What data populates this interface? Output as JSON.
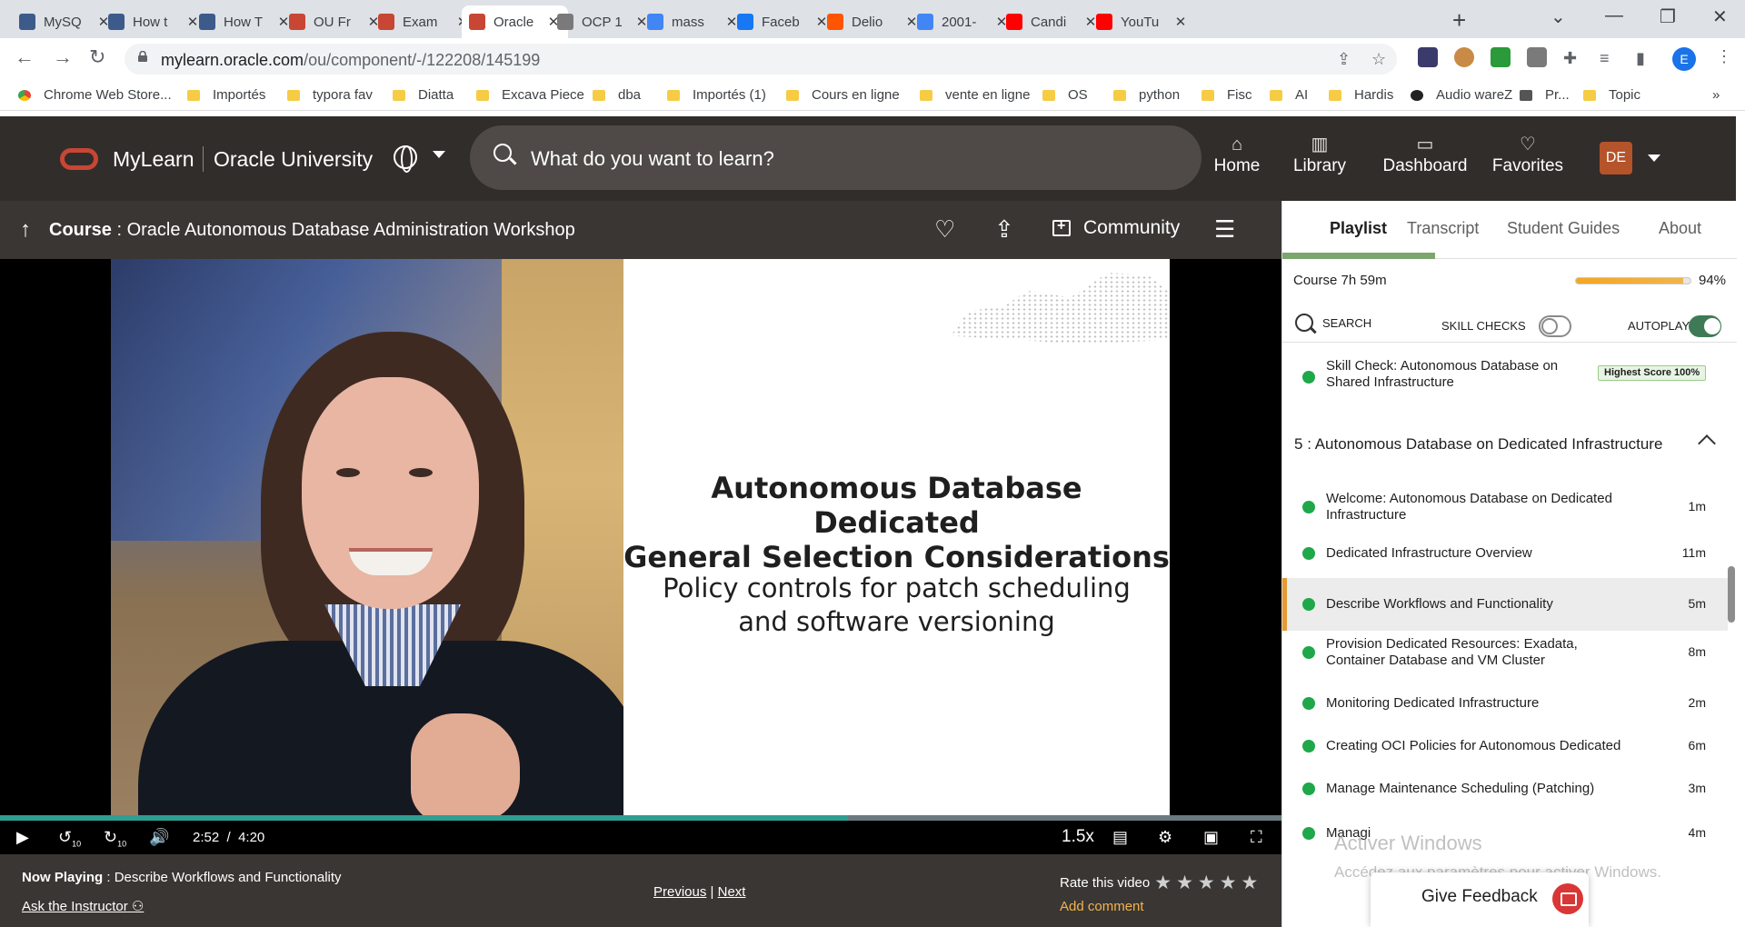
{
  "browser": {
    "tabs": [
      {
        "label": "MySQ",
        "color": "#3c5a8a"
      },
      {
        "label": "How t",
        "color": "#3c5a8a"
      },
      {
        "label": "How T",
        "color": "#3c5a8a"
      },
      {
        "label": "OU Fr",
        "color": "#c74634"
      },
      {
        "label": "Exam",
        "color": "#c74634"
      },
      {
        "label": "Oracle",
        "color": "#c74634"
      },
      {
        "label": "OCP 1",
        "color": "#7a7a7a"
      },
      {
        "label": "mass",
        "color": "#4285f4"
      },
      {
        "label": "Faceb",
        "color": "#1877f2"
      },
      {
        "label": "Delio",
        "color": "#ff5500"
      },
      {
        "label": "2001-",
        "color": "#4285f4"
      },
      {
        "label": "Candi",
        "color": "#ff0000"
      },
      {
        "label": "YouTu",
        "color": "#ff0000"
      }
    ],
    "active_tab_index": 5,
    "url_host": "mylearn.oracle.com",
    "url_path": "/ou/component/-/122208/145199",
    "profile_initial": "E",
    "bookmarks": [
      "Chrome Web Store...",
      "Importés",
      "typora fav",
      "Diatta",
      "Excava Piece",
      "dba",
      "Importés (1)",
      "Cours en ligne",
      "vente en ligne",
      "OS",
      "python",
      "Fisc",
      "AI",
      "Hardis",
      "Audio wareZ",
      "Pr...",
      "Topic"
    ],
    "bookmarks_more": "»"
  },
  "app": {
    "brand": "MyLearn",
    "brand_secondary": "Oracle University",
    "search_placeholder": "What do you want to learn?",
    "nav": [
      {
        "label": "Home",
        "icon": "home-icon"
      },
      {
        "label": "Library",
        "icon": "library-icon"
      },
      {
        "label": "Dashboard",
        "icon": "dashboard-icon"
      },
      {
        "label": "Favorites",
        "icon": "heart-icon"
      }
    ],
    "avatar_initials": "DE",
    "accent": "#c74634"
  },
  "course": {
    "label": "Course",
    "separator": " : ",
    "title": "Oracle Autonomous Database Administration Workshop",
    "community_label": "Community"
  },
  "video": {
    "slide_heading_line1": "Autonomous Database Dedicated",
    "slide_heading_line2": "General Selection Considerations",
    "slide_sub_line1": "Policy controls for patch scheduling",
    "slide_sub_line2": "and software versioning",
    "current_time": "2:52",
    "time_sep": "/",
    "duration": "4:20",
    "progress_fraction": 0.662,
    "speed": "1.5x",
    "skip_back": "10",
    "skip_forward": "10",
    "progress_color": "#2e9e91"
  },
  "below": {
    "now_playing_label": "Now Playing",
    "now_playing_sep": " : ",
    "now_playing_title": "Describe Workflows and Functionality",
    "ask_instructor": "Ask the Instructor",
    "previous": "Previous",
    "pipe": "|",
    "next": "Next",
    "rate_label": "Rate this video",
    "stars": 5,
    "add_comment": "Add comment"
  },
  "sidebar": {
    "tabs": [
      "Playlist",
      "Transcript",
      "Student Guides",
      "About"
    ],
    "active_tab": 0,
    "course_label": "Course",
    "course_duration": "7h 59m",
    "course_progress_pct": 94,
    "course_pct_text": "94%",
    "search_label": "SEARCH",
    "skill_checks_label": "SKILL CHECKS",
    "skill_checks_on": false,
    "autoplay_label": "AUTOPLAY",
    "autoplay_on": true,
    "skill_check_item": {
      "title": "Skill Check: Autonomous Database on Shared Infrastructure",
      "badge": "Highest Score 100%"
    },
    "section": {
      "number": "5",
      "sep": " : ",
      "title": "Autonomous Database on Dedicated Infrastructure"
    },
    "items": [
      {
        "title": "Welcome: Autonomous Database on Dedicated Infrastructure",
        "duration": "1m"
      },
      {
        "title": "Dedicated Infrastructure Overview",
        "duration": "11m"
      },
      {
        "title": "Describe Workflows and Functionality",
        "duration": "5m",
        "current": true
      },
      {
        "title": "Provision Dedicated Resources: Exadata, Container Database and VM Cluster",
        "duration": "8m"
      },
      {
        "title": "Monitoring Dedicated Infrastructure",
        "duration": "2m"
      },
      {
        "title": "Creating OCI Policies for Autonomous Dedicated",
        "duration": "6m"
      },
      {
        "title": "Manage Maintenance Scheduling (Patching)",
        "duration": "3m"
      },
      {
        "title": "Managi",
        "duration": "4m"
      }
    ],
    "feedback_label": "Give Feedback"
  },
  "os_watermark": {
    "line1": "Activer Windows",
    "line2": "Accédez aux paramètres pour activer Windows."
  }
}
